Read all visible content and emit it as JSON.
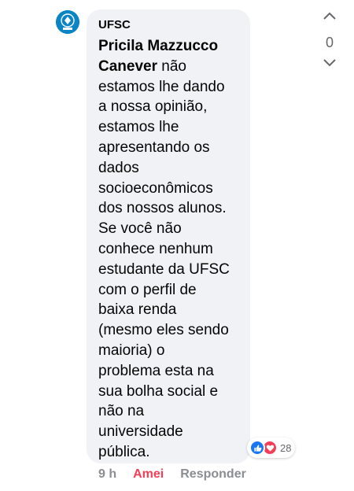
{
  "comment": {
    "author": "UFSC",
    "mention": "Pricila Mazzucco Canever",
    "body_lines": [
      "não",
      "estamos lhe dando",
      "a nossa opinião,",
      "estamos lhe",
      "apresentando os",
      "dados",
      "socioeconômicos",
      "dos nossos alunos.",
      "Se você não",
      "conhece nenhum",
      "estudante da UFSC",
      "com o perfil de",
      "baixa renda",
      "(mesmo eles sendo",
      "maioria) o",
      "problema esta na",
      "sua bolha social e",
      "não na",
      "universidade",
      "pública."
    ],
    "avatar_icon": "ufsc-logo-icon"
  },
  "reactions": {
    "icons": [
      "like-icon",
      "love-icon"
    ],
    "count": "28"
  },
  "actions": {
    "time": "9 h",
    "reaction_label": "Amei",
    "reply_label": "Responder"
  },
  "vote": {
    "count": "0",
    "up_icon": "chevron-up-icon",
    "down_icon": "chevron-down-icon"
  },
  "colors": {
    "bubble_bg": "#f0f2f5",
    "love": "#f33e58",
    "like": "#1877f2",
    "avatar": "#0b84c6",
    "meta_text": "#8a8d91"
  }
}
